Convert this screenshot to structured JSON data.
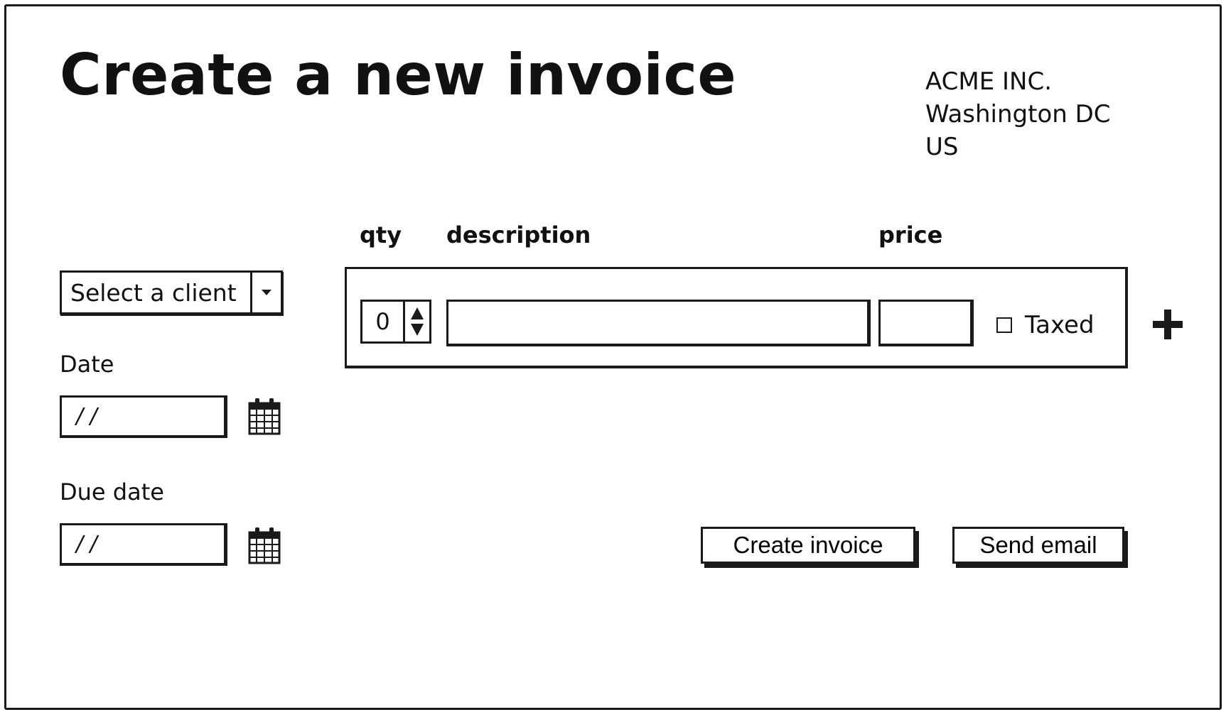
{
  "page": {
    "title": "Create a new invoice"
  },
  "company": {
    "name": "ACME INC.",
    "city": "Washington DC",
    "country": "US"
  },
  "client_select": {
    "selected": "Select a client"
  },
  "date": {
    "label": "Date",
    "value": "/ /"
  },
  "due_date": {
    "label": "Due date",
    "value": "/ /"
  },
  "line_items": {
    "columns": {
      "qty": "qty",
      "description": "description",
      "price": "price"
    },
    "row": {
      "qty": "0",
      "description": "",
      "price": "",
      "taxed_label": "Taxed",
      "taxed_checked": false
    }
  },
  "actions": {
    "create_label": "Create invoice",
    "send_label": "Send email"
  },
  "icons": {
    "calendar": "calendar-icon",
    "add": "plus-icon",
    "dropdown": "triangle-down-icon",
    "spinner": "up-down-arrows-icon"
  }
}
